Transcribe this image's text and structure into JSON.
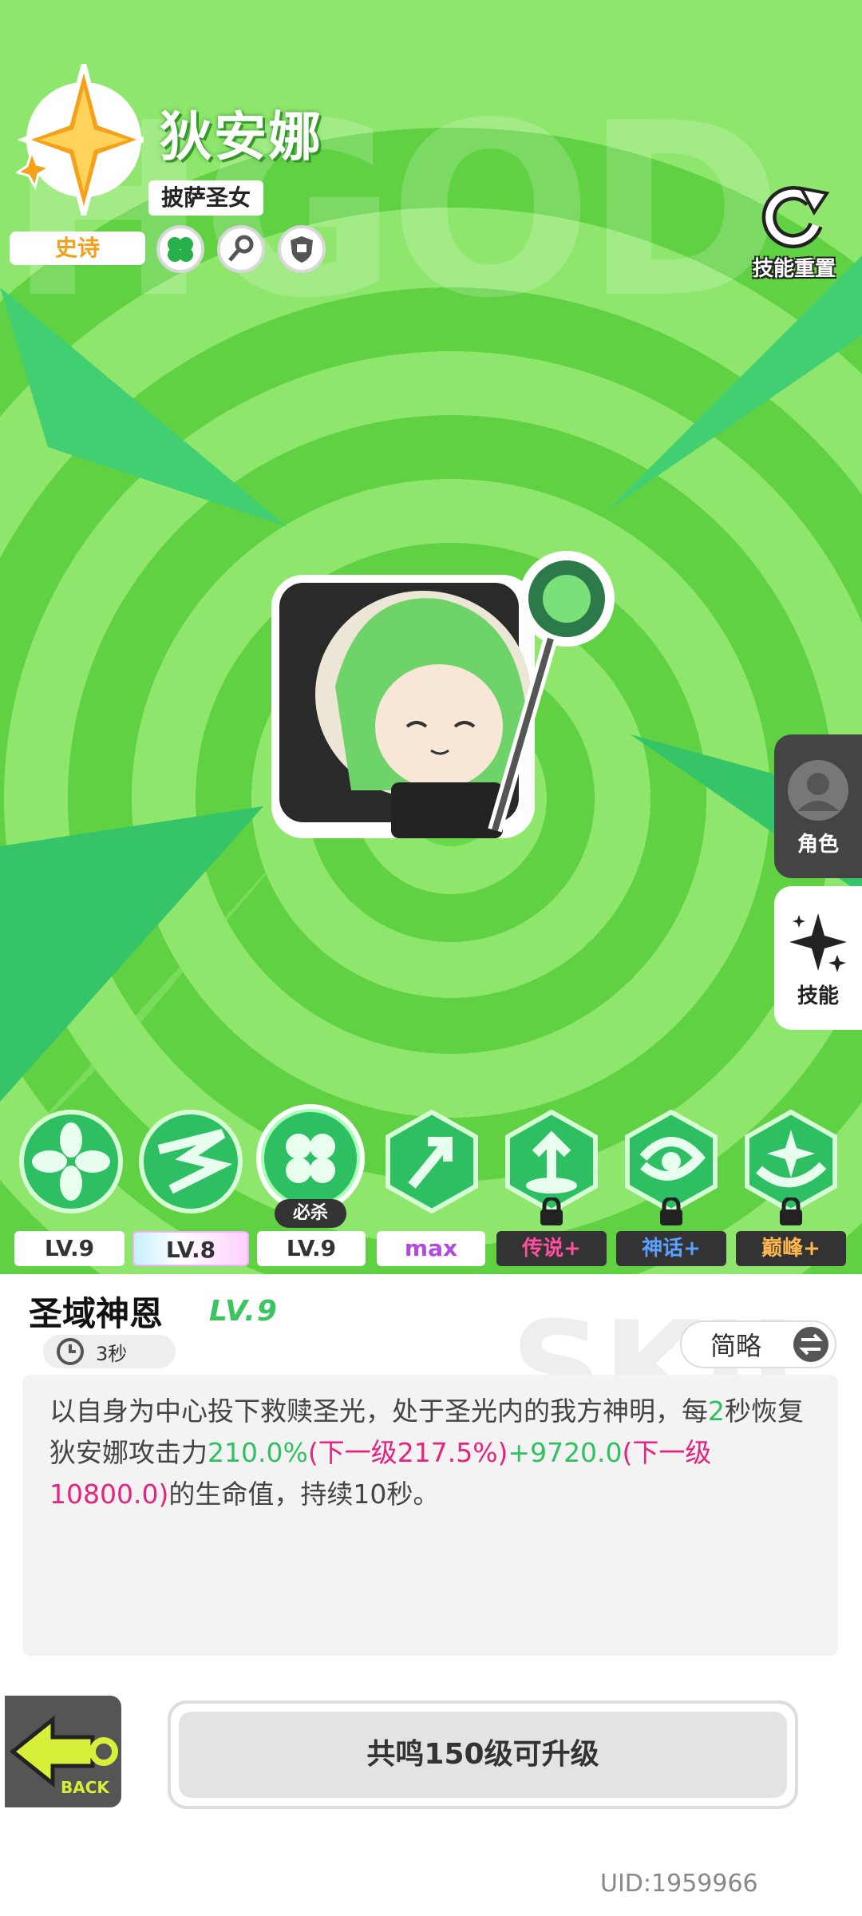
{
  "character": {
    "name": "狄安娜",
    "title": "披萨圣女",
    "rarity": "史诗",
    "traits": [
      "clover-icon",
      "key-icon",
      "shield-icon"
    ]
  },
  "header": {
    "background_text": "HGOD",
    "reset_label": "技能重置"
  },
  "side_tabs": [
    {
      "label": "角色",
      "icon": "avatar-icon"
    },
    {
      "label": "技能",
      "icon": "sparkle-icon"
    }
  ],
  "skills": [
    {
      "level": "LV.9",
      "icon": "flower-skill-icon",
      "locked": false
    },
    {
      "level": "LV.8",
      "icon": "wind-skill-icon",
      "locked": false
    },
    {
      "level": "LV.9",
      "icon": "clover-skill-icon",
      "locked": false,
      "badge": "必杀",
      "selected": true
    },
    {
      "level": "max",
      "icon": "arrow-skill-icon",
      "locked": false
    },
    {
      "level": "传说+",
      "icon": "fountain-skill-icon",
      "locked": true
    },
    {
      "level": "神话+",
      "icon": "swirl-skill-icon",
      "locked": true
    },
    {
      "level": "巅峰+",
      "icon": "star-swirl-skill-icon",
      "locked": true
    }
  ],
  "detail": {
    "skill_name": "圣域神恩",
    "skill_level": "LV.9",
    "cooldown": "3秒",
    "toggle_label": "简略",
    "background_text": "SKIL",
    "description": {
      "p1": "以自身为中心投下救赎圣光，处于圣光内的我方神明，每",
      "p2": "2",
      "p3": "秒恢复狄安娜攻击力",
      "p4": "210.0%",
      "p5": "(下一级217.5%)",
      "p6": "+9720.0",
      "p7": "(下一级10800.0)",
      "p8": "的生命值，持续10秒。"
    }
  },
  "footer": {
    "back_label": "BACK",
    "upgrade_label": "共鸣150级可升级",
    "uid": "UID:1959966"
  },
  "colors": {
    "accent_green": "#3cc460",
    "highlight_magenta": "#e6237d",
    "rarity_gold": "#f0a020",
    "legend_tag": "#ff4fa0",
    "myth_tag": "#5aa0ff",
    "peak_tag": "#ffb84f"
  }
}
